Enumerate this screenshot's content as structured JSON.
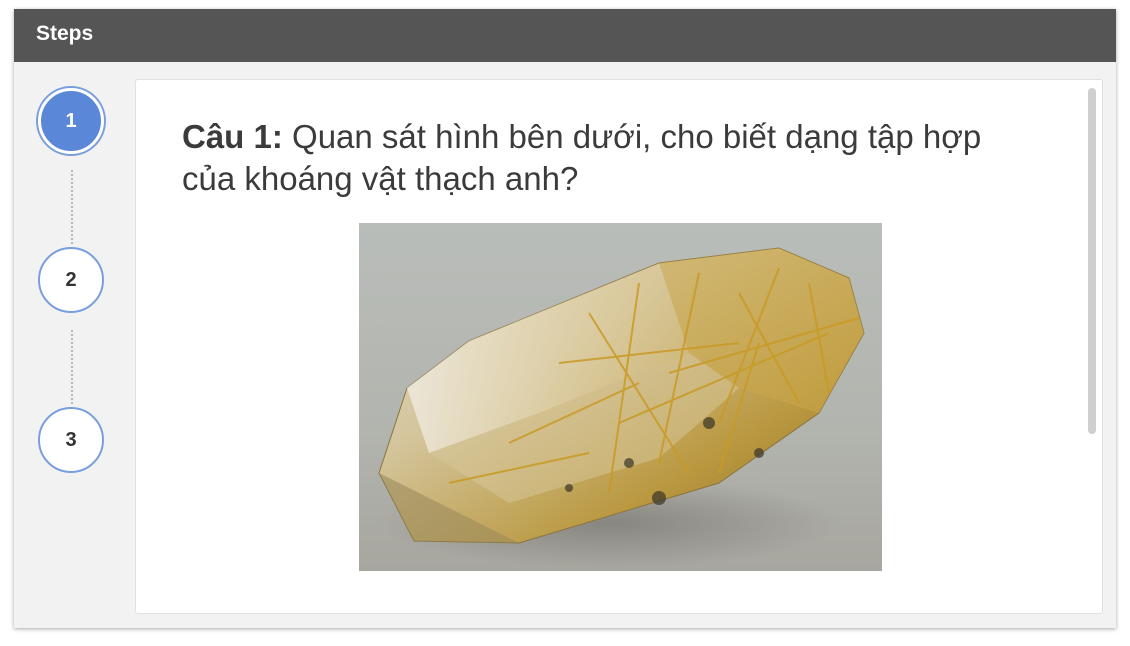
{
  "window": {
    "title": "Steps"
  },
  "steps": [
    {
      "label": "1",
      "active": true
    },
    {
      "label": "2",
      "active": false
    },
    {
      "label": "3",
      "active": false
    }
  ],
  "question": {
    "label": "Câu 1:",
    "text": "Quan sát hình bên dưới, cho biết dạng tập hợp của khoáng vật thạch anh?"
  },
  "image": {
    "subject": "rutilated-quartz-crystal"
  },
  "colors": {
    "titlebar": "#555555",
    "step_active": "#5b87d8",
    "step_border": "#7a9fdc"
  }
}
